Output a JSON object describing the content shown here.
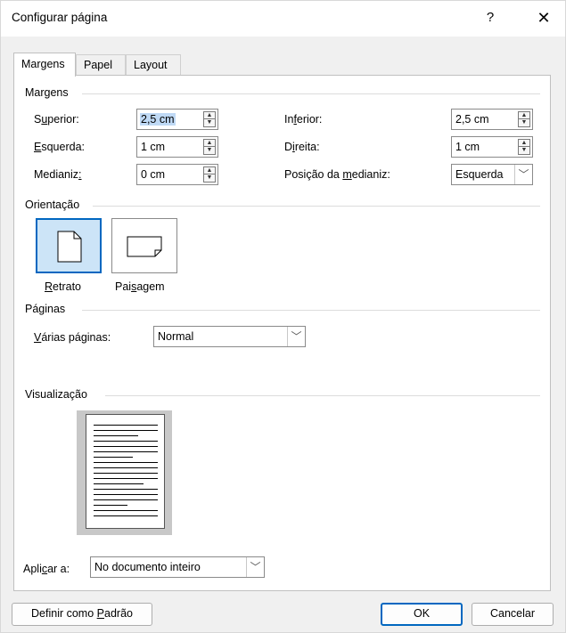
{
  "window": {
    "title": "Configurar página",
    "help_label": "?",
    "close_label": "✕"
  },
  "tabs": [
    {
      "label": "Margens",
      "active": true
    },
    {
      "label": "Papel",
      "active": false
    },
    {
      "label": "Layout",
      "active": false
    }
  ],
  "margins": {
    "section_label": "Margens",
    "superior": {
      "label_pre": "S",
      "label_u": "u",
      "label_post": "perior:",
      "value": "2,5 cm"
    },
    "inferior": {
      "label_pre": "In",
      "label_u": "f",
      "label_post": "erior:",
      "value": "2,5 cm"
    },
    "esquerda": {
      "label_pre": "",
      "label_u": "E",
      "label_post": "squerda:",
      "value": "1 cm"
    },
    "direita": {
      "label_pre": "D",
      "label_u": "i",
      "label_post": "reita:",
      "value": "1 cm"
    },
    "medianiz": {
      "label_pre": "Medianiz",
      "label_u": ":",
      "label_post": "",
      "value": "0 cm"
    },
    "posicao_medianiz": {
      "label_pre": "Posição da ",
      "label_u": "m",
      "label_post": "edianiz:",
      "value": "Esquerda"
    }
  },
  "orientation": {
    "section_label": "Orientação",
    "portrait": {
      "label_pre": "",
      "label_u": "R",
      "label_post": "etrato",
      "selected": true
    },
    "landscape": {
      "label_pre": "Pai",
      "label_u": "s",
      "label_post": "agem",
      "selected": false
    }
  },
  "pages": {
    "section_label": "Páginas",
    "multiple_label_pre": "",
    "multiple_label_u": "V",
    "multiple_label_post": "árias páginas:",
    "multiple_value": "Normal"
  },
  "preview": {
    "section_label": "Visualização"
  },
  "apply_to": {
    "label_pre": "Apli",
    "label_u": "c",
    "label_post": "ar a:",
    "value": "No documento inteiro"
  },
  "footer": {
    "default_pre": "Definir como ",
    "default_u": "P",
    "default_post": "adrão",
    "ok_label": "OK",
    "cancel_label": "Cancelar"
  },
  "colors": {
    "accent": "#0067c0",
    "selection": "#bfd9f5"
  }
}
